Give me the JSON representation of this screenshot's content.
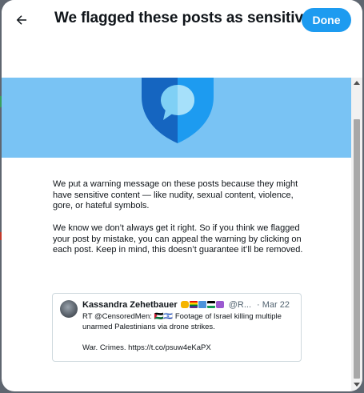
{
  "header": {
    "title": "We flagged these posts as sensitive",
    "done_label": "Done",
    "back_icon": "arrow-left-icon"
  },
  "intro": {
    "paragraph_1": "We put a warning message on these posts because they might have sensitive content — like nudity, sexual content, violence, gore, or hateful symbols.",
    "paragraph_2": "We know we don’t always get it right. So if you think we flagged your post by mistake, you can appeal the warning by clicking on each post. Keep in mind, this doesn’t guarantee it’ll be removed."
  },
  "tweet": {
    "author_name": "Kassandra Zehetbauer",
    "author_emojis": [
      "raised-hand",
      "rainbow-flag",
      "un-flag",
      "palestine-flag",
      "peace-symbol"
    ],
    "handle": "@R...",
    "date": "· Mar 22",
    "text_line_1": "RT @CensoredMen: 🇵🇸🇮🇱 Footage of Israel killing multiple unarmed Palestinians via drone strikes.",
    "text_line_2": "War. Crimes. https://t.co/psuw4eKaPX"
  },
  "colors": {
    "accent": "#1d9bf0",
    "banner": "#79c3f4",
    "shield_dark": "#1565c0",
    "shield_light": "#1d9bf0"
  }
}
